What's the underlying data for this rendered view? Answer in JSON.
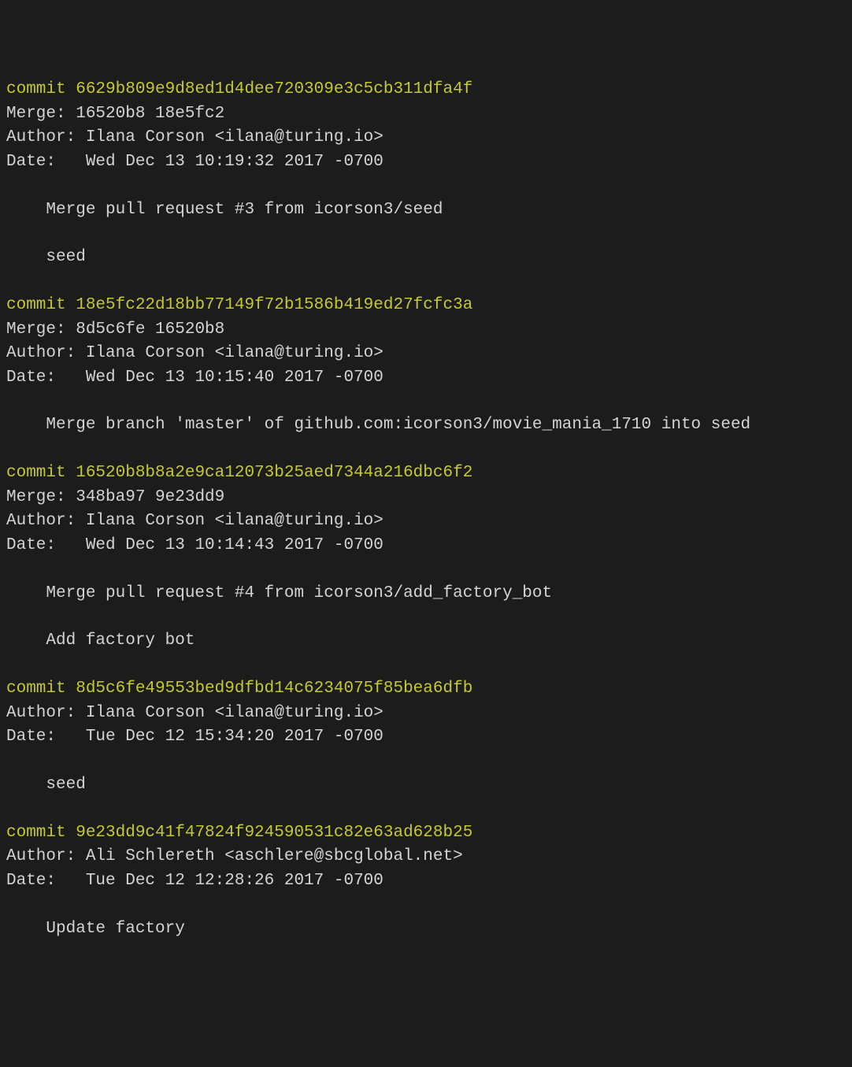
{
  "commits": [
    {
      "hash": "6629b809e9d8ed1d4dee720309e3c5cb311dfa4f",
      "merge": "16520b8 18e5fc2",
      "author": "Ilana Corson <ilana@turing.io>",
      "date": "Wed Dec 13 10:19:32 2017 -0700",
      "messages": [
        "Merge pull request #3 from icorson3/seed",
        "",
        "seed"
      ]
    },
    {
      "hash": "18e5fc22d18bb77149f72b1586b419ed27fcfc3a",
      "merge": "8d5c6fe 16520b8",
      "author": "Ilana Corson <ilana@turing.io>",
      "date": "Wed Dec 13 10:15:40 2017 -0700",
      "messages": [
        "Merge branch 'master' of github.com:icorson3/movie_mania_1710 into seed"
      ]
    },
    {
      "hash": "16520b8b8a2e9ca12073b25aed7344a216dbc6f2",
      "merge": "348ba97 9e23dd9",
      "author": "Ilana Corson <ilana@turing.io>",
      "date": "Wed Dec 13 10:14:43 2017 -0700",
      "messages": [
        "Merge pull request #4 from icorson3/add_factory_bot",
        "",
        "Add factory bot"
      ]
    },
    {
      "hash": "8d5c6fe49553bed9dfbd14c6234075f85bea6dfb",
      "merge": null,
      "author": "Ilana Corson <ilana@turing.io>",
      "date": "Tue Dec 12 15:34:20 2017 -0700",
      "messages": [
        "seed"
      ]
    },
    {
      "hash": "9e23dd9c41f47824f924590531c82e63ad628b25",
      "merge": null,
      "author": "Ali Schlereth <aschlere@sbcglobal.net>",
      "date": "Tue Dec 12 12:28:26 2017 -0700",
      "messages": [
        "Update factory"
      ]
    }
  ],
  "labels": {
    "commit": "commit ",
    "merge": "Merge: ",
    "author": "Author: ",
    "date": "Date:   "
  }
}
